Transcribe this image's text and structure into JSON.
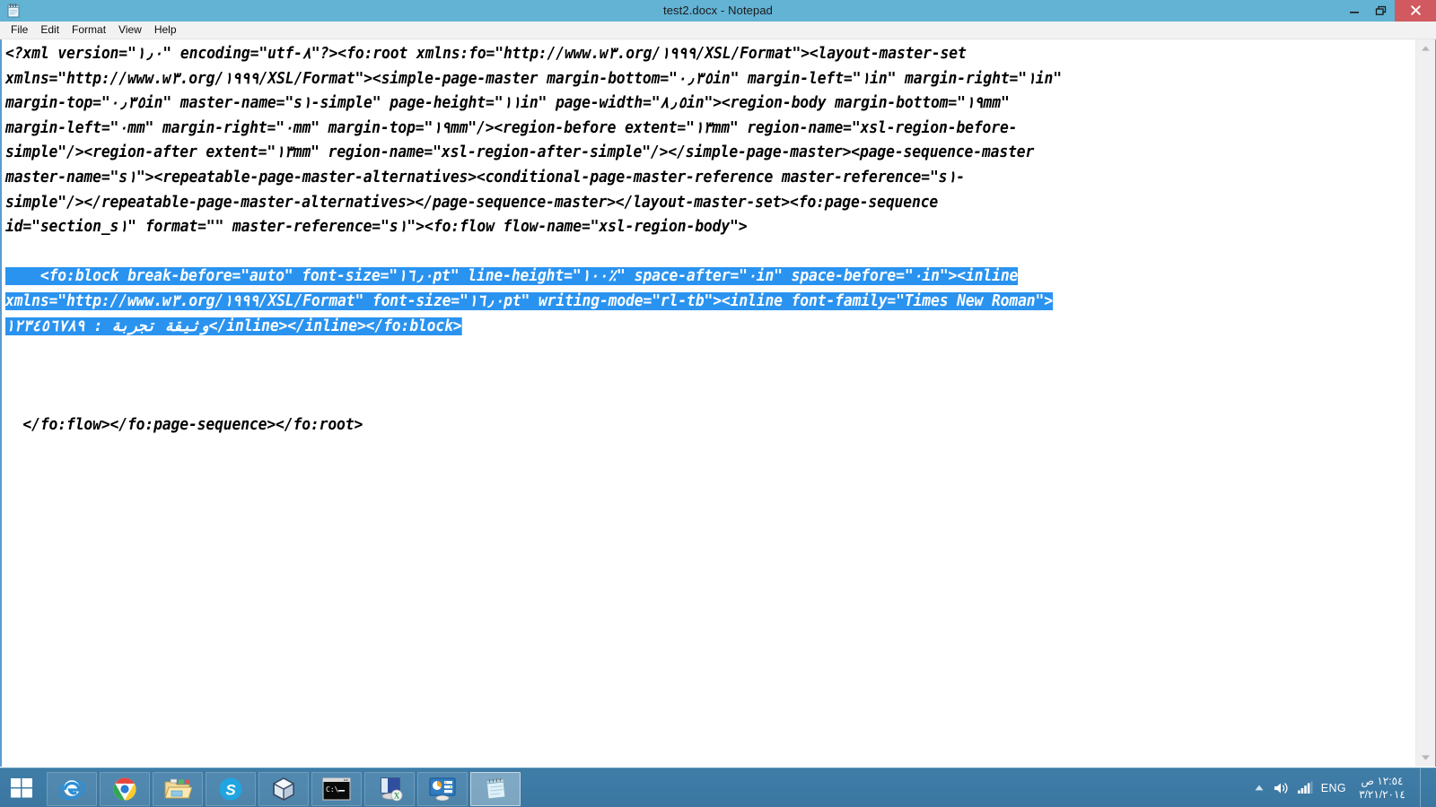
{
  "window": {
    "title": "test2.docx - Notepad",
    "icon": "notepad-icon",
    "controls": {
      "minimize": "Minimize",
      "restore": "Restore",
      "close": "Close"
    }
  },
  "menu": {
    "items": [
      {
        "label": "File"
      },
      {
        "label": "Edit"
      },
      {
        "label": "Format"
      },
      {
        "label": "View"
      },
      {
        "label": "Help"
      }
    ]
  },
  "document": {
    "lines": [
      {
        "type": "text",
        "text": "<?xml version=\"١٫٠\" encoding=\"utf-٨\"?><fo:root xmlns:fo=\"http://www.w٣.org/١٩٩٩/XSL/Format\"><layout-master-set"
      },
      {
        "type": "text",
        "text": "xmlns=\"http://www.w٣.org/١٩٩٩/XSL/Format\"><simple-page-master margin-bottom=\"٠٫٣٥in\" margin-left=\"١in\" margin-right=\"١in\""
      },
      {
        "type": "text",
        "text": "margin-top=\"٠٫٣٥in\" master-name=\"s١-simple\" page-height=\"١١in\" page-width=\"٨٫٥in\"><region-body margin-bottom=\"١٩mm\""
      },
      {
        "type": "text",
        "text": "margin-left=\"٠mm\" margin-right=\"٠mm\" margin-top=\"١٩mm\"/><region-before extent=\"١٣mm\" region-name=\"xsl-region-before-"
      },
      {
        "type": "text",
        "text": "simple\"/><region-after extent=\"١٣mm\" region-name=\"xsl-region-after-simple\"/></simple-page-master><page-sequence-master"
      },
      {
        "type": "text",
        "text": "master-name=\"s١\"><repeatable-page-master-alternatives><conditional-page-master-reference master-reference=\"s١-"
      },
      {
        "type": "text",
        "text": "simple\"/></repeatable-page-master-alternatives></page-sequence-master></layout-master-set><fo:page-sequence"
      },
      {
        "type": "text",
        "text": "id=\"section_s١\" format=\"\" master-reference=\"s١\"><fo:flow flow-name=\"xsl-region-body\">"
      },
      {
        "type": "blank"
      },
      {
        "type": "selected",
        "text": "    <fo:block break-before=\"auto\" font-size=\"١٦٫٠pt\" line-height=\"١٠٠٪\" space-after=\"٠in\" space-before=\"٠in\"><inline"
      },
      {
        "type": "selected",
        "text": "xmlns=\"http://www.w٣.org/١٩٩٩/XSL/Format\" font-size=\"١٦٫٠pt\" writing-mode=\"rl-tb\"><inline font-family=\"Times New Roman\">"
      },
      {
        "type": "selected-rtl",
        "text": "وثيقة تجربة : ١٢٣٤٥٦٧٨٩",
        "tail": "</inline></inline></fo:block>"
      },
      {
        "type": "blank"
      },
      {
        "type": "blank"
      },
      {
        "type": "blank"
      },
      {
        "type": "text",
        "text": "  </fo:flow></fo:page-sequence></fo:root>"
      }
    ],
    "selection_color": "#2a93f0",
    "selection_text_color": "#ffffff"
  },
  "scrollbar": {
    "up_arrow": "chevron-up-icon",
    "down_arrow": "chevron-down-icon"
  },
  "taskbar": {
    "start_label": "Start",
    "items": [
      {
        "name": "internet-explorer",
        "label": "Internet Explorer",
        "active": false
      },
      {
        "name": "google-chrome",
        "label": "Google Chrome",
        "active": false
      },
      {
        "name": "file-explorer",
        "label": "File Explorer",
        "active": false
      },
      {
        "name": "skype",
        "label": "Skype",
        "active": false
      },
      {
        "name": "virtualbox",
        "label": "Oracle VM VirtualBox",
        "active": false
      },
      {
        "name": "command-prompt",
        "label": "Command Prompt",
        "active": false
      },
      {
        "name": "remote-desktop",
        "label": "Xming X Server",
        "active": false
      },
      {
        "name": "control-panel",
        "label": "Control Panel",
        "active": false
      },
      {
        "name": "notepad",
        "label": "test2.docx - Notepad",
        "active": true
      }
    ],
    "tray": {
      "show_hidden": "show-hidden-icons",
      "volume": "speaker-icon",
      "network": "network-signal-icon",
      "language": "ENG",
      "time": "١٢:٥٤ ص",
      "date": "٣/٢١/٢٠١٤"
    }
  },
  "colors": {
    "titlebar": "#62b3d4",
    "close_button": "#d05a5f",
    "taskbar": "#3d7ba6",
    "selection": "#2a93f0",
    "window_border": "#5b9bd1"
  }
}
